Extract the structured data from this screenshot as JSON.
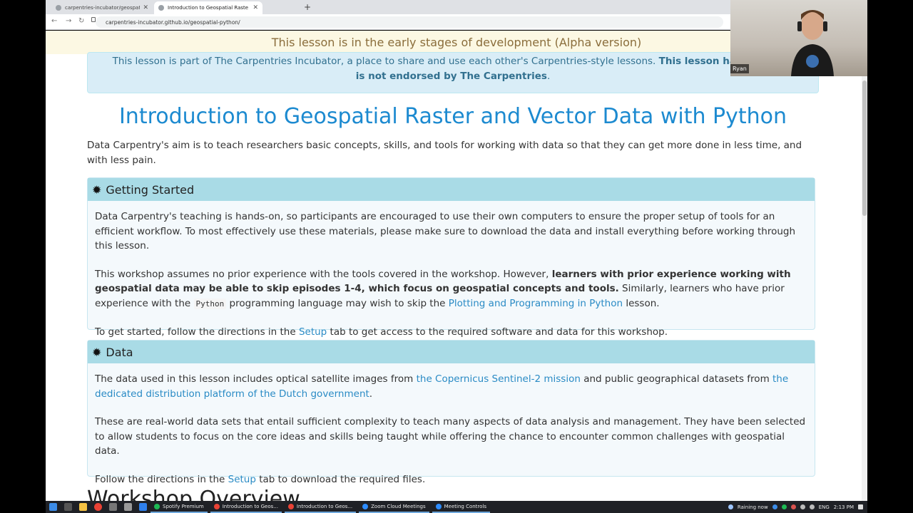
{
  "browser": {
    "tabs": [
      {
        "label": "carpentries-incubator/geospatial",
        "active": false
      },
      {
        "label": "Introduction to Geospatial Raste",
        "active": true
      }
    ],
    "new_tab": "+",
    "url": "carpentries-incubator.github.io/geospatial-python/"
  },
  "banner": {
    "alpha_text": "This lesson is in the early stages of development (Alpha version)"
  },
  "incubator": {
    "prefix": "This lesson is part of ",
    "link": "The Carpentries Incubator",
    "mid": ", a place to share and use each other's Carpentries-style lessons. ",
    "bold_1": "This lesson has not been",
    "bold_2": "is not endorsed by The Carpentries",
    "end": "."
  },
  "lesson": {
    "title": "Introduction to Geospatial Raster and Vector Data with Python",
    "intro": "Data Carpentry's aim is to teach researchers basic concepts, skills, and tools for working with data so that they can get more done in less time, and with less pain."
  },
  "getting_started": {
    "heading": "Getting Started",
    "p1": "Data Carpentry's teaching is hands-on, so participants are encouraged to use their own computers to ensure the proper setup of tools for an efficient workflow. To most effectively use these materials, please make sure to download the data and install everything before working through this lesson.",
    "p2_a": "This workshop assumes no prior experience with the tools covered in the workshop. However, ",
    "p2_bold": "learners with prior experience working with geospatial data may be able to skip episodes 1-4, which focus on geospatial concepts and tools.",
    "p2_b": " Similarly, learners who have prior experience with the ",
    "p2_code": "Python",
    "p2_c": " programming language may wish to skip the ",
    "p2_link": "Plotting and Programming in Python",
    "p2_d": " lesson.",
    "p3_a": "To get started, follow the directions in the ",
    "p3_link": "Setup",
    "p3_b": " tab to get access to the required software and data for this workshop."
  },
  "data_section": {
    "heading": "Data",
    "p1_a": "The data used in this lesson includes optical satellite images from ",
    "p1_link1": "the Copernicus Sentinel-2 mission",
    "p1_b": " and public geographical datasets from ",
    "p1_link2": "the dedicated distribution platform of the Dutch government",
    "p1_c": ".",
    "p2": "These are real-world data sets that entail sufficient complexity to teach many aspects of data analysis and management. They have been selected to allow students to focus on the core ideas and skills being taught while offering the chance to encounter common challenges with geospatial data.",
    "p3_a": "Follow the directions in the ",
    "p3_link": "Setup",
    "p3_b": " tab to download the required files."
  },
  "next_section": {
    "title": "Workshop Overview"
  },
  "webcam": {
    "name": "Ryan"
  },
  "taskbar": {
    "apps": [
      {
        "label": "Spotify Premium",
        "color": "#1db954"
      },
      {
        "label": "Introduction to Geos...",
        "color": "#e94235"
      },
      {
        "label": "Introduction to Geos...",
        "color": "#e94235"
      },
      {
        "label": "Zoom Cloud Meetings",
        "color": "#2d8cff"
      },
      {
        "label": "Meeting Controls",
        "color": "#2d8cff"
      }
    ],
    "weather": "Raining now",
    "lang": "ENG",
    "time": "2:13 PM"
  }
}
